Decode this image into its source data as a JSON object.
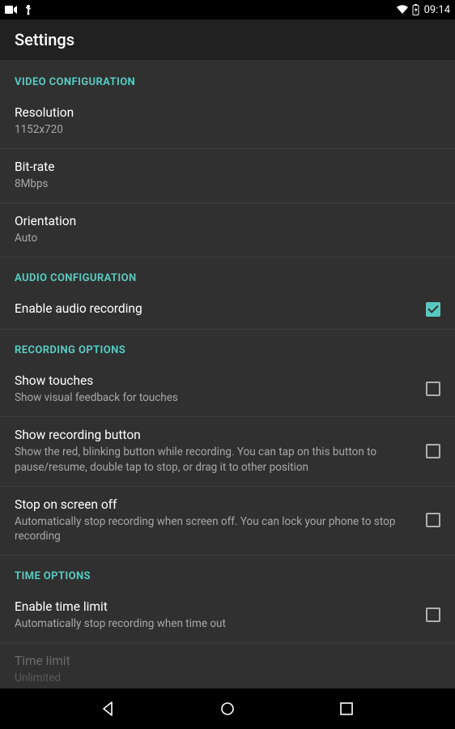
{
  "status": {
    "time": "09:14"
  },
  "appbar": {
    "title": "Settings"
  },
  "sections": {
    "video": {
      "header": "VIDEO CONFIGURATION",
      "resolution": {
        "title": "Resolution",
        "value": "1152x720"
      },
      "bitrate": {
        "title": "Bit-rate",
        "value": "8Mbps"
      },
      "orientation": {
        "title": "Orientation",
        "value": "Auto"
      }
    },
    "audio": {
      "header": "AUDIO CONFIGURATION",
      "enable": {
        "title": "Enable audio recording"
      }
    },
    "recording": {
      "header": "RECORDING OPTIONS",
      "touches": {
        "title": "Show touches",
        "summary": "Show visual feedback for touches"
      },
      "button": {
        "title": "Show recording button",
        "summary": "Show the red, blinking button while recording. You can tap on this button to pause/resume, double tap to stop, or drag it to other position"
      },
      "screenoff": {
        "title": "Stop on screen off",
        "summary": "Automatically stop recording when screen off. You can lock your phone to stop recording"
      }
    },
    "time": {
      "header": "TIME OPTIONS",
      "enable": {
        "title": "Enable time limit",
        "summary": "Automatically stop recording when time out"
      },
      "limit": {
        "title": "Time limit",
        "summary": "Unlimited"
      }
    }
  }
}
